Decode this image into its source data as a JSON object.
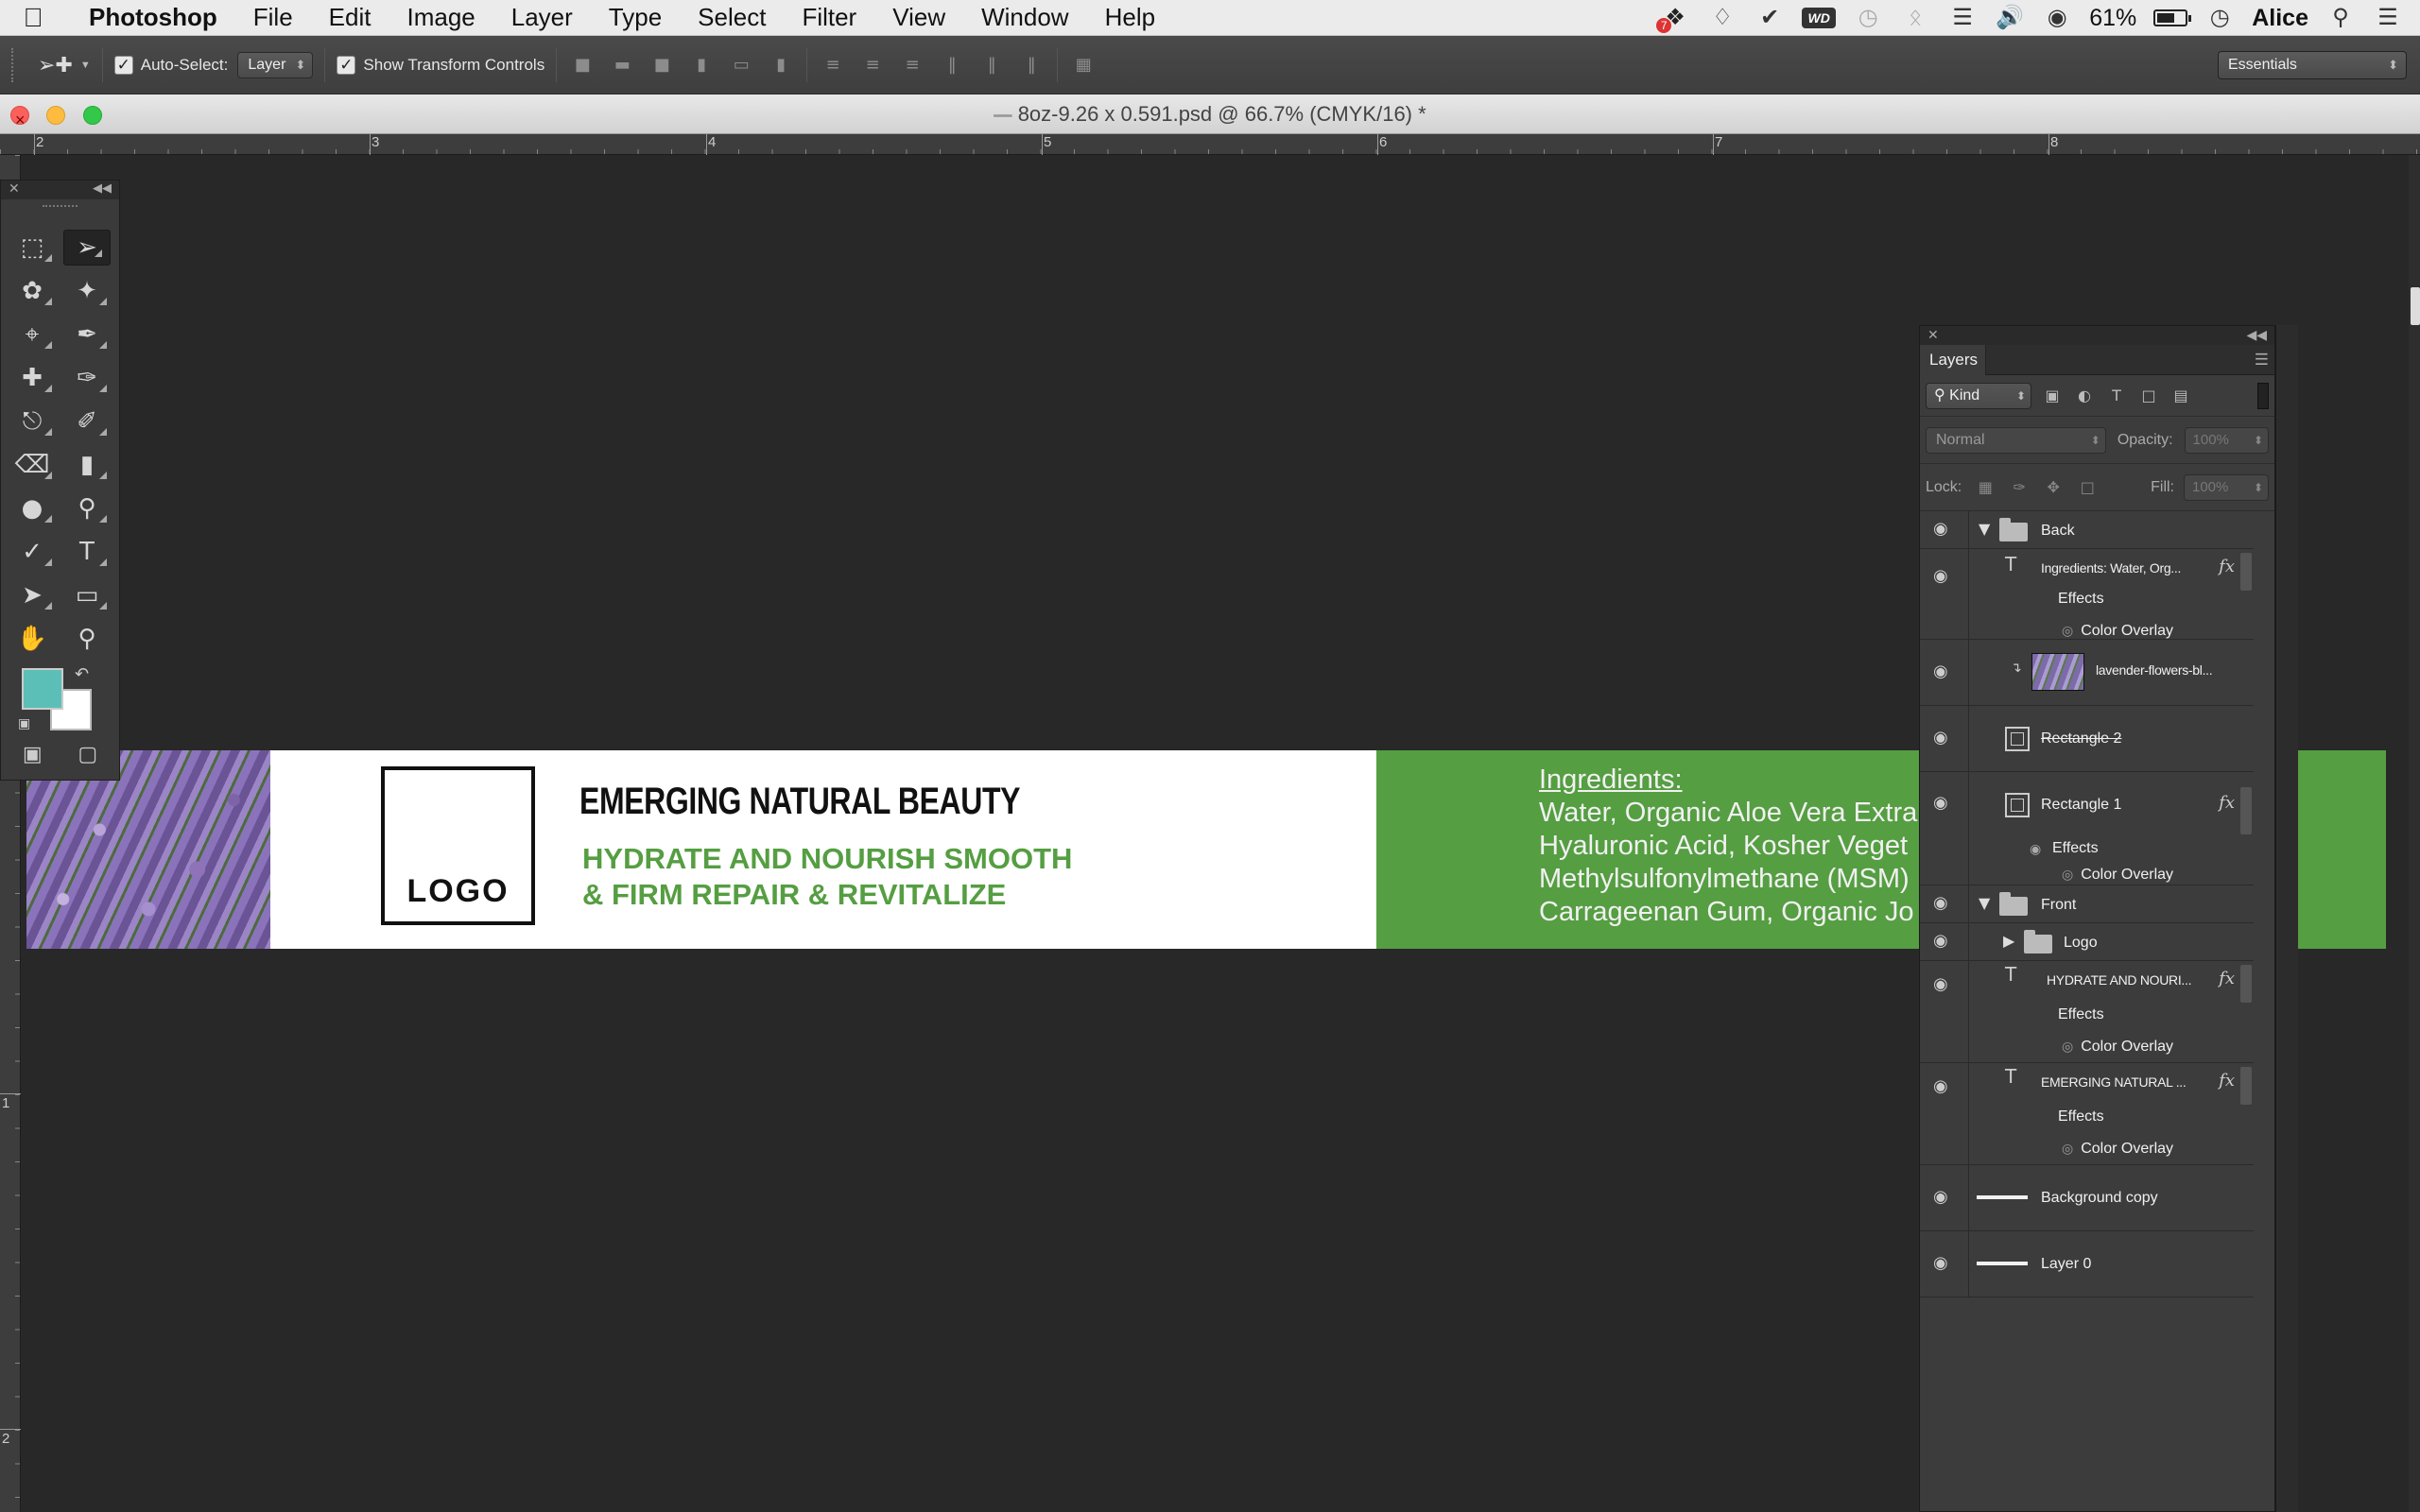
{
  "menubar": {
    "app_name": "Photoshop",
    "menus": [
      "File",
      "Edit",
      "Image",
      "Layer",
      "Type",
      "Select",
      "Filter",
      "View",
      "Window",
      "Help"
    ],
    "battery_percent": "61%",
    "battery_level": 0.61,
    "user": "Alice",
    "status_icons": [
      "dropbox-icon",
      "evernote-icon",
      "check-icon",
      "wd-icon",
      "time-machine-icon",
      "bluetooth-icon",
      "wifi-icon",
      "volume-icon",
      "vpn-icon",
      "clock-icon",
      "spotlight-icon",
      "notification-center-icon"
    ],
    "dropbox_badge": "7",
    "wd_label": "WD"
  },
  "options_bar": {
    "auto_select_label": "Auto-Select:",
    "auto_select_checked": true,
    "auto_select_value": "Layer",
    "show_transform_label": "Show Transform Controls",
    "show_transform_checked": true,
    "workspace": "Essentials"
  },
  "document": {
    "title": "8oz-9.26 x 0.591.psd @ 66.7% (CMYK/16) *"
  },
  "rulers": {
    "top_labels": [
      "2",
      "3",
      "4",
      "5",
      "6",
      "7",
      "8"
    ],
    "left_labels": [
      "1",
      "2"
    ]
  },
  "tools": {
    "foreground_color": "#5cbfb7",
    "background_color": "#ffffff"
  },
  "canvas": {
    "logo_text": "LOGO",
    "headline": "EMERGING NATURAL BEAUTY",
    "tagline_line1": "HYDRATE AND NOURISH SMOOTH",
    "tagline_line2": "& FIRM REPAIR & REVITALIZE",
    "ingredients_heading": "Ingredients:",
    "ingredients_lines": [
      "Water, Organic Aloe Vera Extra",
      "Hyaluronic Acid, Kosher Veget",
      "Methylsulfonylmethane (MSM)",
      "Carrageenan Gum, Organic Jo"
    ],
    "green_color": "#559e42",
    "teal_color": "#5cbfb7"
  },
  "layers_panel": {
    "tab": "Layers",
    "filter_kind": "Kind",
    "blend_mode": "Normal",
    "opacity_label": "Opacity:",
    "opacity_value": "100%",
    "lock_label": "Lock:",
    "fill_label": "Fill:",
    "fill_value": "100%",
    "effects_label": "Effects",
    "color_overlay_label": "Color Overlay",
    "layers": {
      "back": "Back",
      "ingredients": "Ingredients: Water, Org...",
      "lavender": "lavender-flowers-bl...",
      "rect2": "Rectangle 2",
      "rect1": "Rectangle 1",
      "front": "Front",
      "logo": "Logo",
      "hydrate": "HYDRATE AND NOURI...",
      "emerging": "EMERGING NATURAL ...",
      "bg_copy": "Background copy",
      "layer0": "Layer 0"
    }
  }
}
